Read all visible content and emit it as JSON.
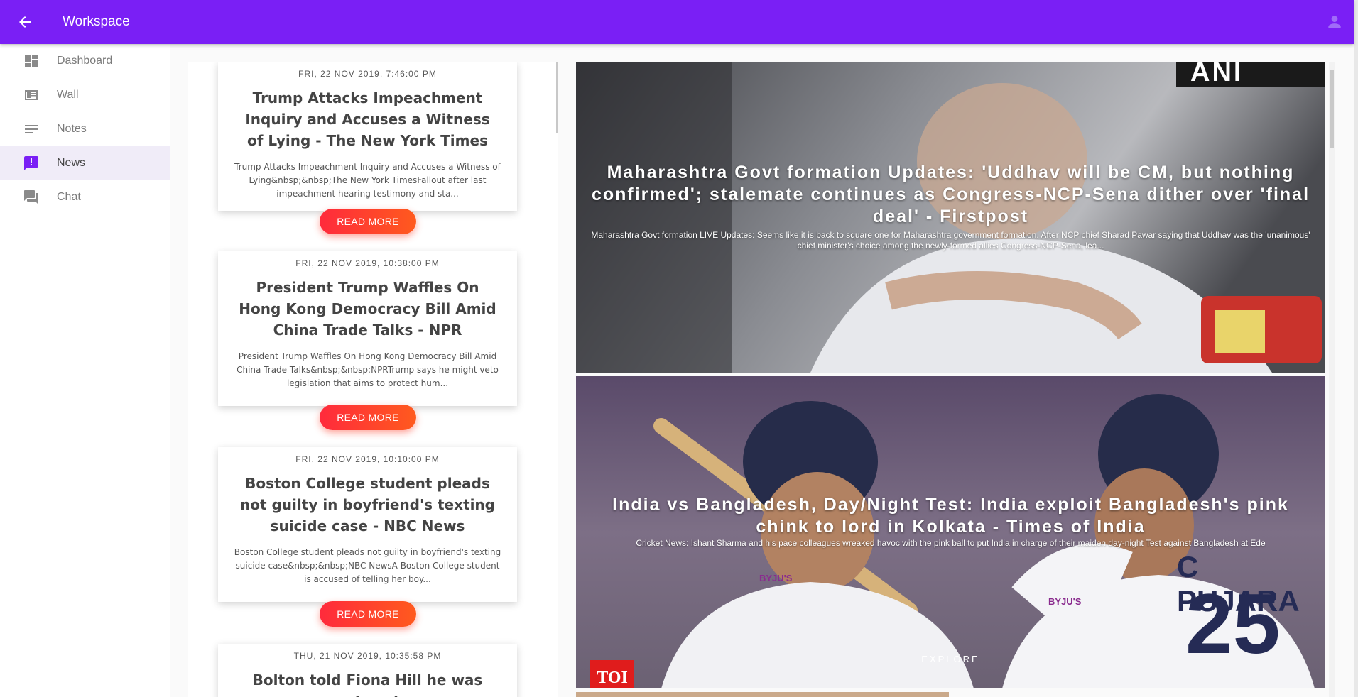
{
  "appbar": {
    "title": "Workspace",
    "back_icon": "arrow-left-icon",
    "user_icon": "account-icon",
    "color": "#7a1ff5"
  },
  "sidebar": {
    "items": [
      {
        "label": "Dashboard",
        "icon": "dashboard-icon",
        "active": false
      },
      {
        "label": "Wall",
        "icon": "wall-icon",
        "active": false
      },
      {
        "label": "Notes",
        "icon": "notes-icon",
        "active": false
      },
      {
        "label": "News",
        "icon": "news-icon",
        "active": true
      },
      {
        "label": "Chat",
        "icon": "chat-icon",
        "active": false
      }
    ]
  },
  "news": [
    {
      "date": "FRI, 22 NOV 2019, 7:46:00 PM",
      "headline": "Trump Attacks Impeachment Inquiry and Accuses a Witness of Lying - The New York Times",
      "description": "Trump Attacks Impeachment Inquiry and Accuses a Witness of Lying&nbsp;&nbsp;The New York TimesFallout after last impeachment hearing testimony and sta...",
      "button": "READ MORE"
    },
    {
      "date": "FRI, 22 NOV 2019, 10:38:00 PM",
      "headline": "President Trump Waffles On Hong Kong Democracy Bill Amid China Trade Talks - NPR",
      "description": "President Trump Waffles On Hong Kong Democracy Bill Amid China Trade Talks&nbsp;&nbsp;NPRTrump says he might veto legislation that aims to protect hum...",
      "button": "READ MORE"
    },
    {
      "date": "FRI, 22 NOV 2019, 10:10:00 PM",
      "headline": "Boston College student pleads not guilty in boyfriend's texting suicide case - NBC News",
      "description": "Boston College student pleads not guilty in boyfriend's texting suicide case&nbsp;&nbsp;NBC NewsA Boston College student is accused of telling her boy...",
      "button": "READ MORE"
    },
    {
      "date": "THU, 21 NOV 2019, 10:35:58 PM",
      "headline": "Bolton told Fiona Hill he was not part"
    }
  ],
  "featured": [
    {
      "title": "Maharashtra Govt formation Updates: 'Uddhav will be CM, but nothing confirmed'; stalemate continues as Congress-NCP-Sena dither over 'final deal' - Firstpost",
      "description": "Maharashtra Govt formation LIVE Updates: Seems like it is back to square one for Maharashtra government formation. After NCP chief Sharad Pawar saying that Uddhav was the 'unanimous' chief minister's choice among the newly-formed allies Congress-NCP-Sena, lea...",
      "watermark": "ANI"
    },
    {
      "title": "India vs Bangladesh, Day/Night Test: India exploit Bangladesh's pink chink to lord in Kolkata - Times of India",
      "description": "Cricket News: Ishant Sharma and his pace colleagues wreaked havoc with the pink ball to put India in charge of their maiden day-night Test against Bangladesh at Ede",
      "explore": "EXPLORE",
      "logo": "TOI",
      "jersey_name": "C PUJARA",
      "jersey_number": "25",
      "sponsor": "BYJU'S"
    }
  ]
}
